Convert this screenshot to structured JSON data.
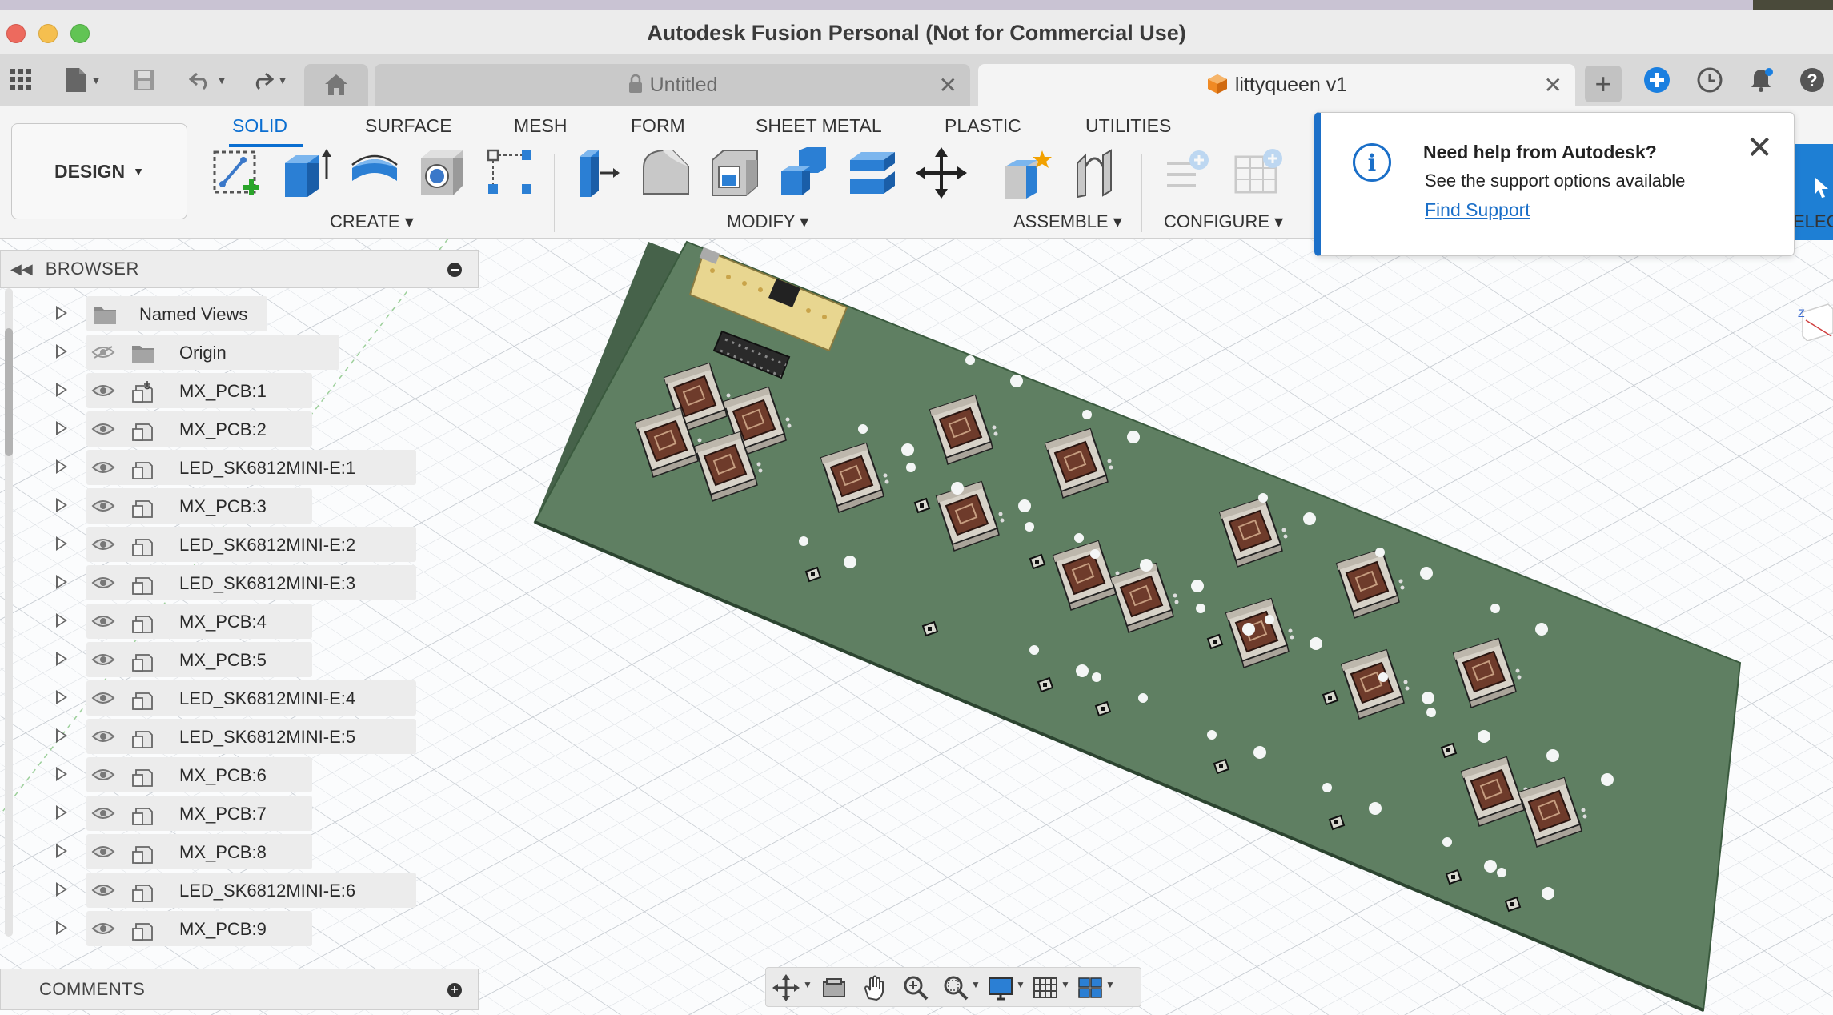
{
  "window": {
    "title": "Autodesk Fusion Personal (Not for Commercial Use)"
  },
  "tabs": {
    "untitled": "Untitled",
    "active": "littyqueen v1"
  },
  "ribbon": {
    "design_label": "DESIGN",
    "workspace_tabs": [
      "SOLID",
      "SURFACE",
      "MESH",
      "FORM",
      "SHEET METAL",
      "PLASTIC",
      "UTILITIES"
    ],
    "groups": {
      "create": "CREATE",
      "modify": "MODIFY",
      "assemble": "ASSEMBLE",
      "configure": "CONFIGURE"
    },
    "select_partial": "ELECT"
  },
  "browser": {
    "title": "BROWSER",
    "items": [
      {
        "label": "Named Views",
        "icon": "folder-icon"
      },
      {
        "label": "Origin",
        "icon": "folder-icon",
        "hidden": true
      },
      {
        "label": "MX_PCB:1",
        "icon": "component-anchored-icon"
      },
      {
        "label": "MX_PCB:2",
        "icon": "component-icon"
      },
      {
        "label": "LED_SK6812MINI-E:1",
        "icon": "component-icon"
      },
      {
        "label": "MX_PCB:3",
        "icon": "component-icon"
      },
      {
        "label": "LED_SK6812MINI-E:2",
        "icon": "component-icon"
      },
      {
        "label": "LED_SK6812MINI-E:3",
        "icon": "component-icon"
      },
      {
        "label": "MX_PCB:4",
        "icon": "component-icon"
      },
      {
        "label": "MX_PCB:5",
        "icon": "component-icon"
      },
      {
        "label": "LED_SK6812MINI-E:4",
        "icon": "component-icon"
      },
      {
        "label": "LED_SK6812MINI-E:5",
        "icon": "component-icon"
      },
      {
        "label": "MX_PCB:6",
        "icon": "component-icon"
      },
      {
        "label": "MX_PCB:7",
        "icon": "component-icon"
      },
      {
        "label": "MX_PCB:8",
        "icon": "component-icon"
      },
      {
        "label": "LED_SK6812MINI-E:6",
        "icon": "component-icon"
      },
      {
        "label": "MX_PCB:9",
        "icon": "component-icon"
      }
    ]
  },
  "comments": {
    "title": "COMMENTS"
  },
  "help": {
    "title": "Need help from Autodesk?",
    "body": "See the support options available",
    "link": "Find Support"
  },
  "colors": {
    "accent": "#0a6ed1",
    "pcb": "#5f7f62",
    "switch_body": "#c9c3b8",
    "switch_stem": "#6b3a2a",
    "microcontroller": "#e8d690"
  }
}
